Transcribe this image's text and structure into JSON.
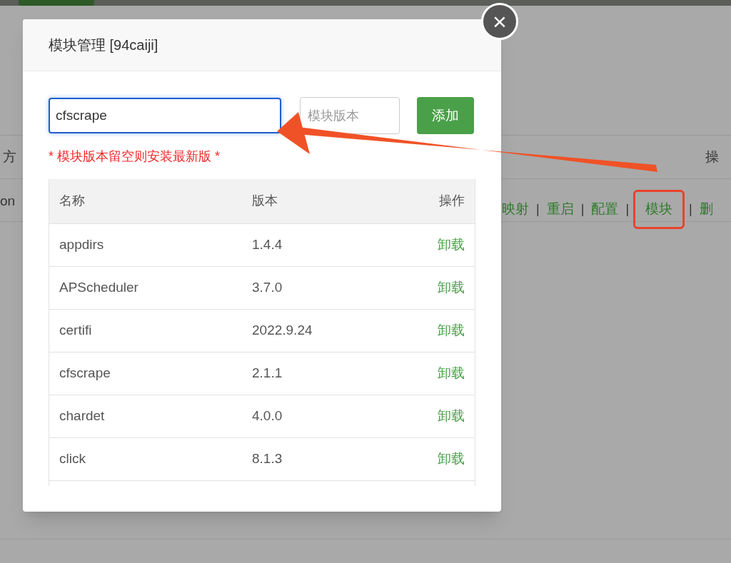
{
  "background": {
    "header_cells": [
      "方",
      "操"
    ],
    "row_cells": [
      "on"
    ],
    "actions": [
      {
        "label": "映射",
        "highlighted": false
      },
      {
        "label": "重启",
        "highlighted": false
      },
      {
        "label": "配置",
        "highlighted": false
      },
      {
        "label": "模块",
        "highlighted": true
      },
      {
        "label": "删",
        "highlighted": false
      }
    ],
    "separator": "|"
  },
  "dialog": {
    "title": "模块管理 [94caiji]",
    "close": "×",
    "name_input": {
      "value": "cfscrape",
      "focused": true
    },
    "version_input": {
      "placeholder": "模块版本"
    },
    "add_button": "添加",
    "hint": "* 模块版本留空则安装最新版 *",
    "table": {
      "columns": [
        "名称",
        "版本",
        "操作"
      ],
      "rows": [
        {
          "name": "appdirs",
          "version": "1.4.4",
          "action": "卸载"
        },
        {
          "name": "APScheduler",
          "version": "3.7.0",
          "action": "卸载"
        },
        {
          "name": "certifi",
          "version": "2022.9.24",
          "action": "卸载"
        },
        {
          "name": "cfscrape",
          "version": "2.1.1",
          "action": "卸载"
        },
        {
          "name": "chardet",
          "version": "4.0.0",
          "action": "卸载"
        },
        {
          "name": "click",
          "version": "8.1.3",
          "action": "卸载"
        }
      ]
    }
  }
}
